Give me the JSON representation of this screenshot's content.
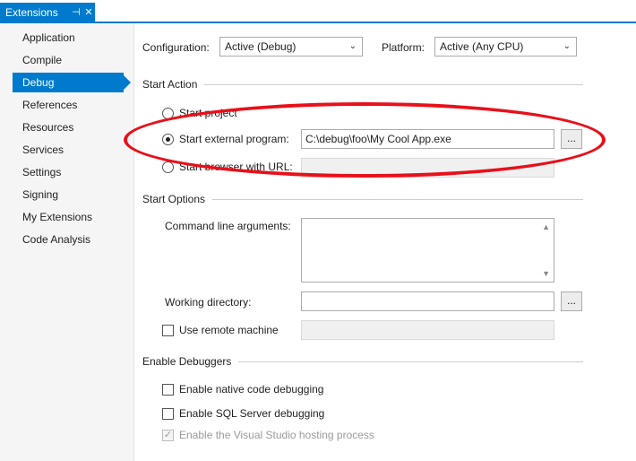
{
  "tabstrip": {
    "tab_label": "Extensions",
    "pin_icon": "pin-icon",
    "close_icon": "close-icon",
    "accent": "#007acc"
  },
  "nav": {
    "items": [
      {
        "label": "Application"
      },
      {
        "label": "Compile"
      },
      {
        "label": "Debug"
      },
      {
        "label": "References"
      },
      {
        "label": "Resources"
      },
      {
        "label": "Services"
      },
      {
        "label": "Settings"
      },
      {
        "label": "Signing"
      },
      {
        "label": "My Extensions"
      },
      {
        "label": "Code Analysis"
      }
    ],
    "active": "Debug"
  },
  "config": {
    "configuration_label": "Configuration:",
    "configuration_value": "Active (Debug)",
    "platform_label": "Platform:",
    "platform_value": "Active (Any CPU)"
  },
  "start_action": {
    "title": "Start Action",
    "start_project": "Start project",
    "start_external": "Start external program:",
    "external_path": "C:\\debug\\foo\\My Cool App.exe",
    "browse_label": "...",
    "start_browser": "Start browser with URL:"
  },
  "start_options": {
    "title": "Start Options",
    "cmd_args_label": "Command line arguments:",
    "working_dir_label": "Working directory:",
    "browse_label": "...",
    "remote_label": "Use remote machine"
  },
  "debuggers": {
    "title": "Enable Debuggers",
    "native": "Enable native code debugging",
    "sql": "Enable SQL Server debugging",
    "hosting": "Enable the Visual Studio hosting process"
  },
  "annotation_color": "#e8101a"
}
